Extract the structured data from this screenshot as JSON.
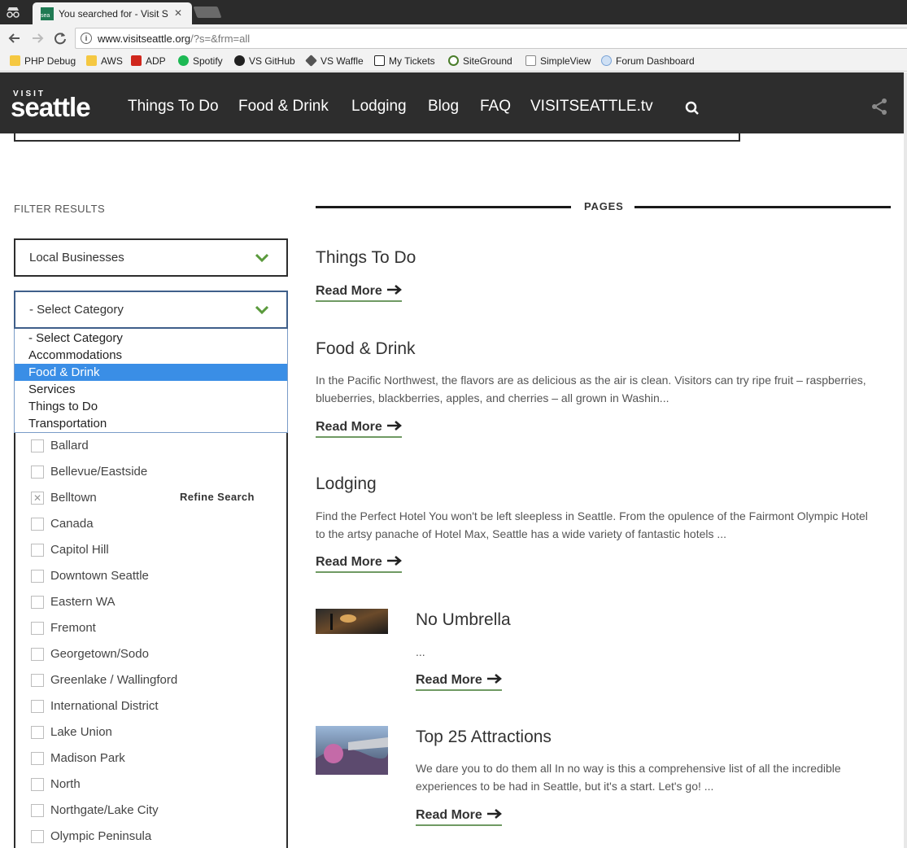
{
  "browser": {
    "tab_title": "You searched for - Visit S",
    "tab_close": "✕",
    "url_host": "www.visitseattle.org",
    "url_path": "/?s=&frm=all",
    "bookmarks": [
      "PHP Debug",
      "AWS",
      "ADP",
      "Spotify",
      "VS GitHub",
      "VS Waffle",
      "My Tickets",
      "SiteGround",
      "SimpleView",
      "Forum Dashboard"
    ],
    "favicon_text": "sea"
  },
  "header": {
    "logo_small": "VISIT",
    "logo_big": "seattle",
    "nav": [
      "Things To Do",
      "Food & Drink",
      "Lodging",
      "Blog",
      "FAQ",
      "VISITSEATTLE.tv"
    ]
  },
  "filters": {
    "title": "FILTER RESULTS",
    "type_select": "Local Businesses",
    "category_select": "- Select Category",
    "category_options": [
      "- Select Category",
      "Accommodations",
      "Food & Drink",
      "Services",
      "Things to Do",
      "Transportation"
    ],
    "category_highlighted": "Food & Drink",
    "neighborhoods": [
      {
        "label": "Ballard",
        "checked": false
      },
      {
        "label": "Bellevue/Eastside",
        "checked": false
      },
      {
        "label": "Belltown",
        "checked": true
      },
      {
        "label": "Canada",
        "checked": false
      },
      {
        "label": "Capitol Hill",
        "checked": false
      },
      {
        "label": "Downtown Seattle",
        "checked": false
      },
      {
        "label": "Eastern WA",
        "checked": false
      },
      {
        "label": "Fremont",
        "checked": false
      },
      {
        "label": "Georgetown/Sodo",
        "checked": false
      },
      {
        "label": "Greenlake / Wallingford",
        "checked": false
      },
      {
        "label": "International District",
        "checked": false
      },
      {
        "label": "Lake Union",
        "checked": false
      },
      {
        "label": "Madison Park",
        "checked": false
      },
      {
        "label": "North",
        "checked": false
      },
      {
        "label": "Northgate/Lake City",
        "checked": false
      },
      {
        "label": "Olympic Peninsula",
        "checked": false
      }
    ],
    "refine_label": "Refine Search"
  },
  "results": {
    "section_label": "PAGES",
    "read_more": "Read More",
    "items": [
      {
        "title": "Things To Do",
        "desc": ""
      },
      {
        "title": "Food & Drink",
        "desc": "In the Pacific Northwest, the flavors are as delicious as the air is clean. Visitors can try ripe fruit – raspberries, blueberries, blackberries, apples, and cherries – all grown in Washin..."
      },
      {
        "title": "Lodging",
        "desc": "Find the Perfect Hotel You won't be left sleepless in Seattle. From the opulence of the Fairmont Olympic Hotel to the artsy panache of Hotel Max, Seattle has a wide variety of fantastic hotels ..."
      },
      {
        "title": "No Umbrella",
        "desc": "..."
      },
      {
        "title": "Top 25 Attractions",
        "desc": "We dare you to do them all In no way is this a comprehensive list of all the incredible experiences to be had in Seattle, but it's a start. Let's go! ..."
      }
    ]
  },
  "colors": {
    "header_bg": "#2d2d2d",
    "accent_green": "#5a9a3c",
    "dropdown_highlight": "#3a8ee6"
  }
}
